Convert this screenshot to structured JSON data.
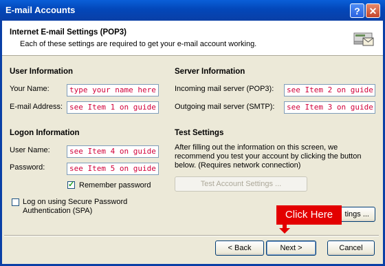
{
  "window": {
    "title": "E-mail Accounts",
    "help_glyph": "?",
    "close_glyph": "✕"
  },
  "header": {
    "title": "Internet E-mail Settings (POP3)",
    "subtitle": "Each of these settings are required to get your e-mail account working."
  },
  "user_info": {
    "heading": "User Information",
    "name_label": "Your Name:",
    "name_value": "type your name here",
    "email_label": "E-mail Address:",
    "email_value": "see Item 1 on guide"
  },
  "server_info": {
    "heading": "Server Information",
    "incoming_label": "Incoming mail server (POP3):",
    "incoming_value": "see Item 2 on guide",
    "outgoing_label": "Outgoing mail server (SMTP):",
    "outgoing_value": "see Item 3 on guide"
  },
  "logon_info": {
    "heading": "Logon Information",
    "username_label": "User Name:",
    "username_value": "see Item 4 on guide",
    "password_label": "Password:",
    "password_value": "see Item 5 on guide",
    "remember_label": "Remember password",
    "spa_label_line1": "Log on using Secure Password",
    "spa_label_line2": "Authentication (SPA)"
  },
  "test_settings": {
    "heading": "Test Settings",
    "line1": "After filling out the information on this screen, we",
    "line2": "recommend you test your account by clicking the button",
    "line3": "below. (Requires network connection)",
    "test_button": "Test Account Settings ...",
    "more_settings_button": "tings ..."
  },
  "annotation": {
    "callout": "Click Here"
  },
  "footer": {
    "back": "< Back",
    "next": "Next >",
    "cancel": "Cancel"
  },
  "colors": {
    "accent_red": "#e30000",
    "field_text": "#d2003a",
    "title_blue": "#0347b9"
  }
}
